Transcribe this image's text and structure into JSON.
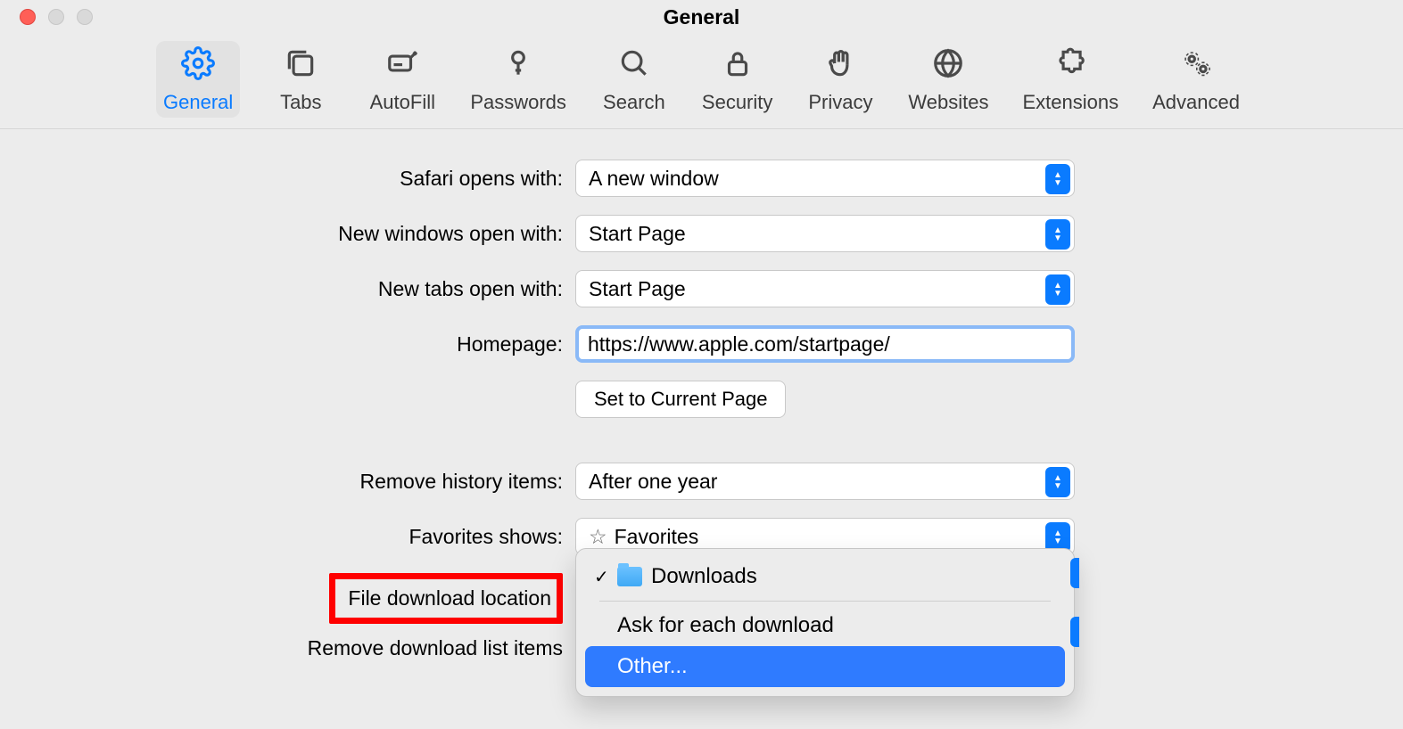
{
  "window": {
    "title": "General"
  },
  "toolbar": {
    "items": [
      {
        "label": "General"
      },
      {
        "label": "Tabs"
      },
      {
        "label": "AutoFill"
      },
      {
        "label": "Passwords"
      },
      {
        "label": "Search"
      },
      {
        "label": "Security"
      },
      {
        "label": "Privacy"
      },
      {
        "label": "Websites"
      },
      {
        "label": "Extensions"
      },
      {
        "label": "Advanced"
      }
    ]
  },
  "form": {
    "safari_opens_with": {
      "label": "Safari opens with:",
      "value": "A new window"
    },
    "new_windows_open_with": {
      "label": "New windows open with:",
      "value": "Start Page"
    },
    "new_tabs_open_with": {
      "label": "New tabs open with:",
      "value": "Start Page"
    },
    "homepage": {
      "label": "Homepage:",
      "value": "https://www.apple.com/startpage/"
    },
    "set_current_page": "Set to Current Page",
    "remove_history": {
      "label": "Remove history items:",
      "value": "After one year"
    },
    "favorites_shows": {
      "label": "Favorites shows:",
      "value": "Favorites"
    },
    "file_download_location": {
      "label": "File download location"
    },
    "remove_download_list": {
      "label": "Remove download list items"
    }
  },
  "dropdown": {
    "items": [
      {
        "label": "Downloads",
        "checked": true,
        "icon": "folder"
      },
      {
        "label": "Ask for each download"
      },
      {
        "label": "Other...",
        "highlight": true
      }
    ]
  }
}
